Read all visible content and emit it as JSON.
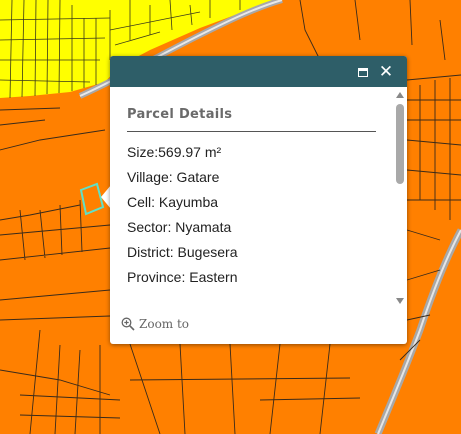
{
  "popup": {
    "title": "Parcel Details",
    "maximize_icon": "maximize-icon",
    "close_icon": "close-icon",
    "attributes": [
      "Size:569.97 m²",
      "Village: Gatare",
      "Cell: Kayumba",
      "Sector: Nyamata",
      "District: Bugesera",
      "Province: Eastern"
    ],
    "zoom_to": "Zoom to",
    "zoom_icon": "zoom-in-icon"
  },
  "colors": {
    "parcel_fill": "#ff8000",
    "residential_fill": "#ffff00",
    "road": "#a8a8a8",
    "parcel_line": "#3a2a1a",
    "highlight": "#5fe0c8",
    "header": "#2e5e68"
  }
}
